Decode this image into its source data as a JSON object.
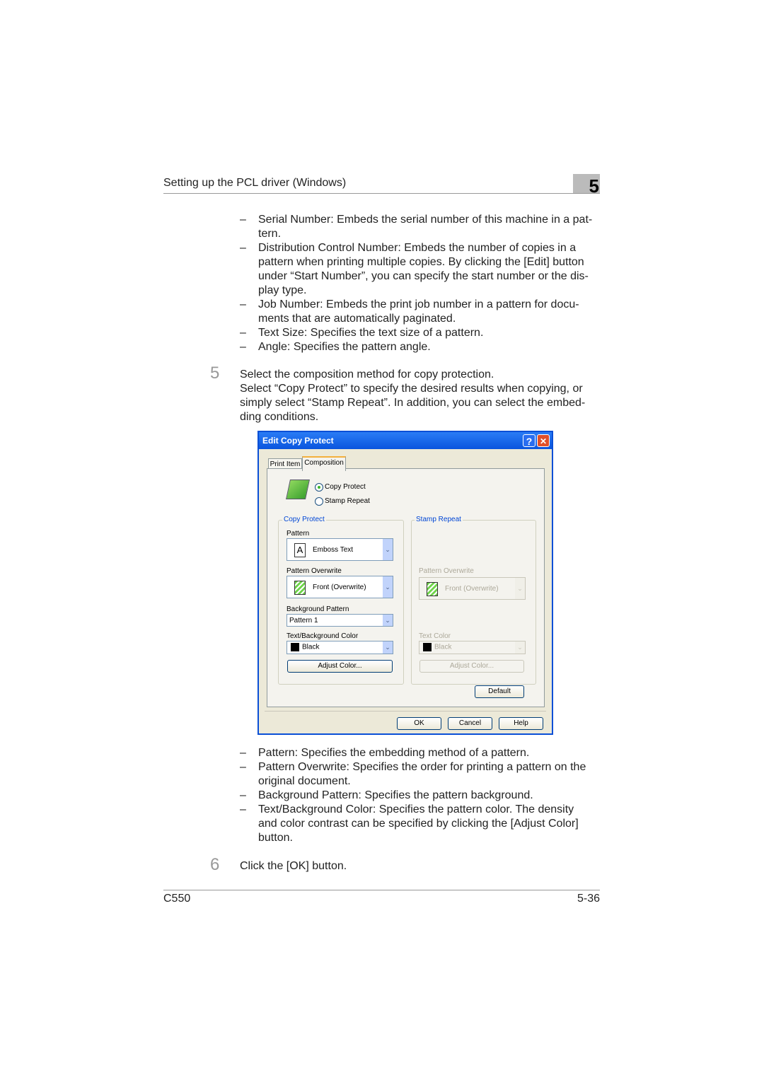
{
  "header": {
    "title": "Setting up the PCL driver (Windows)",
    "chapter": "5"
  },
  "bullets_top": [
    [
      "Serial Number: Embeds the serial number of this machine in a pat-",
      "tern."
    ],
    [
      "Distribution Control Number: Embeds the number of copies in a",
      "pattern when printing multiple copies. By clicking the [Edit] button",
      "under “Start Number”, you can specify the start number or the dis-",
      "play type."
    ],
    [
      "Job Number: Embeds the print job number in a pattern for docu-",
      "ments that are automatically paginated."
    ],
    [
      "Text Size: Specifies the text size of a pattern."
    ],
    [
      "Angle: Specifies the pattern angle."
    ]
  ],
  "step5": {
    "number": "5",
    "lines": [
      "Select the composition method for copy protection.",
      "Select “Copy Protect” to specify the desired results when copying, or",
      "simply select “Stamp Repeat”. In addition, you can select the embed-",
      "ding conditions."
    ]
  },
  "dialog": {
    "title": "Edit Copy Protect",
    "help_icon": "?",
    "close_icon": "✕",
    "tabs": [
      "Print Item",
      "Composition"
    ],
    "active_tab": "Composition",
    "radios": {
      "copy_protect": "Copy Protect",
      "stamp_repeat": "Stamp Repeat",
      "selected": "Copy Protect"
    },
    "copy_protect": {
      "group": "Copy Protect",
      "pattern_label": "Pattern",
      "pattern_value": "Emboss Text",
      "overwrite_label": "Pattern Overwrite",
      "overwrite_value": "Front (Overwrite)",
      "bg_label": "Background Pattern",
      "bg_value": "Pattern 1",
      "color_label": "Text/Background Color",
      "color_value": "Black",
      "adjust": "Adjust Color..."
    },
    "stamp_repeat": {
      "group": "Stamp Repeat",
      "overwrite_label": "Pattern Overwrite",
      "overwrite_value": "Front (Overwrite)",
      "color_label": "Text Color",
      "color_value": "Black",
      "adjust": "Adjust Color..."
    },
    "default": "Default",
    "ok": "OK",
    "cancel": "Cancel",
    "help": "Help"
  },
  "bullets_bottom": [
    [
      "Pattern: Specifies the embedding method of a pattern."
    ],
    [
      "Pattern Overwrite: Specifies the order for printing a pattern on the",
      "original document."
    ],
    [
      "Background Pattern: Specifies the pattern background."
    ],
    [
      "Text/Background Color: Specifies the pattern color. The density",
      "and color contrast can be specified by clicking the [Adjust Color]",
      "button."
    ]
  ],
  "step6": {
    "number": "6",
    "text": "Click the [OK] button."
  },
  "footer": {
    "model": "C550",
    "page": "5-36"
  },
  "dash": "–"
}
